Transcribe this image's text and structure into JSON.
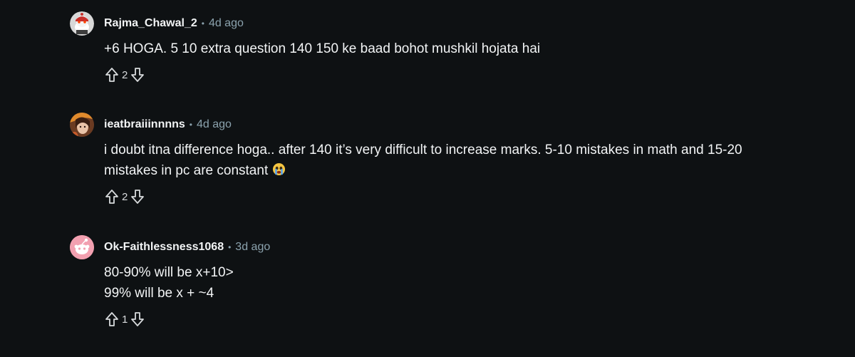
{
  "comments": [
    {
      "username": "Rajma_Chawal_2",
      "separator": "•",
      "timestamp": "4d ago",
      "lines": [
        "+6 HOGA. 5 10 extra question 140 150 ke baad bohot mushkil hojata hai"
      ],
      "score": "2",
      "avatar": "snoo-avatar-red-helmet"
    },
    {
      "username": "ieatbraiiinnnns",
      "separator": "•",
      "timestamp": "4d ago",
      "lines": [
        "i doubt itna difference hoga.. after 140 it’s very difficult to increase marks. 5-10 mistakes in math and 15-20",
        "mistakes in pc are constant"
      ],
      "emoji": "crying-face-emoji",
      "score": "2",
      "avatar": "anime-profile-avatar"
    },
    {
      "username": "Ok-Faithlessness1068",
      "separator": "•",
      "timestamp": "3d ago",
      "lines": [
        "80-90% will be x+10>",
        "99% will be x + ~4"
      ],
      "score": "1",
      "avatar": "default-snoo-avatar-pink"
    }
  ],
  "colors": {
    "background": "#0e1113",
    "text": "#f2f4f5",
    "meta": "#8ba2ad",
    "vote_icon": "#d7dadc"
  }
}
